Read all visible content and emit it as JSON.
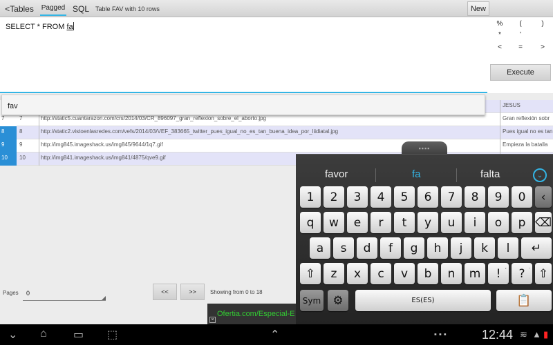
{
  "toolbar": {
    "tables_label": "<Tables",
    "pagged_label": "Pagged",
    "sql_label": "SQL",
    "table_info": "Table FAV with 10 rows",
    "new_label": "New"
  },
  "editor": {
    "sql_prefix": "SELECT * FROM ",
    "sql_current_word": "fa"
  },
  "symbols": [
    "%",
    "(",
    ")",
    "*",
    "'",
    "<",
    "=",
    ">"
  ],
  "execute_label": "Execute",
  "autocomplete": {
    "item": "fav"
  },
  "rows": [
    {
      "id": "",
      "num": "",
      "url": "",
      "desc": "JESUS",
      "style": "alt",
      "selected": false
    },
    {
      "id": "7",
      "num": "7",
      "url": "http://static5.cuantarazon.com/crs/2014/03/CR_896097_gran_reflexion_sobre_el_aborto.jpg",
      "desc": "Gran reflexión sobr",
      "style": "plain",
      "selected": false
    },
    {
      "id": "8",
      "num": "8",
      "url": "http://static2.vistoenlasredes.com/vefs/2014/03/VEF_383665_twitter_pues_igual_no_es_tan_buena_idea_por_liidiatal.jpg",
      "desc": "Pues igual no es tan",
      "style": "alt",
      "selected": true
    },
    {
      "id": "9",
      "num": "9",
      "url": "http://img845.imageshack.us/img845/9644/1q7.gif",
      "desc": "Empieza la batalla",
      "style": "plain",
      "selected": true
    },
    {
      "id": "10",
      "num": "10",
      "url": "http://img841.imageshack.us/img841/4875/qve9.gif",
      "desc": "",
      "style": "alt",
      "selected": true
    }
  ],
  "paging": {
    "pages_label": "Pages",
    "pages_value": "0",
    "prev_label": "<<",
    "next_label": ">>",
    "showing": "Showing from 0 to 18"
  },
  "ad": {
    "text": "Ofertia.com/Especial-E"
  },
  "keyboard": {
    "suggestions": [
      "favor",
      "fa",
      "falta"
    ],
    "row_numbers": [
      "1",
      "2",
      "3",
      "4",
      "5",
      "6",
      "7",
      "8",
      "9",
      "0"
    ],
    "row_q": [
      "q",
      "w",
      "e",
      "r",
      "t",
      "y",
      "u",
      "i",
      "o",
      "p"
    ],
    "row_a": [
      "a",
      "s",
      "d",
      "f",
      "g",
      "h",
      "j",
      "k",
      "l"
    ],
    "row_z": [
      "z",
      "x",
      "c",
      "v",
      "b",
      "n",
      "m",
      "!",
      "?"
    ],
    "row_z_small": [
      "",
      "",
      "",
      "",
      "",
      "",
      "",
      ",",
      "."
    ],
    "sym_label": "Sym",
    "space_label": "ES(ES)"
  },
  "statusbar": {
    "time": "12:44"
  },
  "colors": {
    "accent": "#33b5e5",
    "selected_row": "#2a8fd6",
    "alt_row": "#e3e3f8"
  },
  "icons": [
    "back-icon",
    "home-icon",
    "recent-apps-icon",
    "screenshot-icon",
    "hide-keyboard-icon",
    "settings-icon",
    "wifi-icon",
    "battery-icon",
    "backspace-icon",
    "enter-icon",
    "shift-icon",
    "clipboard-icon"
  ]
}
